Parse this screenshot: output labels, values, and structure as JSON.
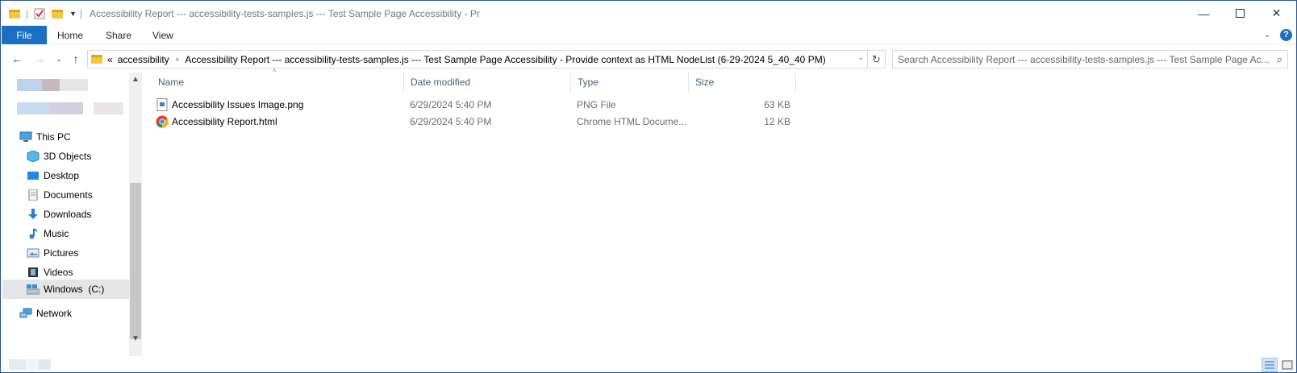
{
  "window": {
    "title": "Accessibility Report --- accessibility-tests-samples.js --- Test Sample Page Accessibility - Pr",
    "accent_color": "#1a6fc4"
  },
  "ribbon": {
    "tabs": [
      "File",
      "Home",
      "Share",
      "View"
    ]
  },
  "address": {
    "overflow_glyph": "«",
    "crumbs": [
      "accessibility",
      "Accessibility Report --- accessibility-tests-samples.js --- Test Sample Page Accessibility - Provide context as HTML NodeList (6-29-2024 5_40_40 PM)"
    ],
    "search_placeholder": "Search Accessibility Report --- accessibility-tests-samples.js --- Test Sample Page Ac..."
  },
  "nav": {
    "items": [
      {
        "label": "This PC",
        "icon": "computer-icon"
      },
      {
        "label": "3D Objects",
        "icon": "cube-icon"
      },
      {
        "label": "Desktop",
        "icon": "desktop-icon"
      },
      {
        "label": "Documents",
        "icon": "documents-icon"
      },
      {
        "label": "Downloads",
        "icon": "download-arrow-icon"
      },
      {
        "label": "Music",
        "icon": "music-note-icon"
      },
      {
        "label": "Pictures",
        "icon": "pictures-icon"
      },
      {
        "label": "Videos",
        "icon": "film-icon"
      },
      {
        "label": "Windows  (C:)",
        "icon": "drive-icon"
      },
      {
        "label": "Network",
        "icon": "network-icon"
      }
    ],
    "selected": "Windows  (C:)"
  },
  "columns": [
    "Name",
    "Date modified",
    "Type",
    "Size"
  ],
  "files": [
    {
      "name": "Accessibility Issues Image.png",
      "date": "6/29/2024 5:40 PM",
      "type": "PNG File",
      "size": "63 KB",
      "icon": "image-file-icon"
    },
    {
      "name": "Accessibility Report.html",
      "date": "6/29/2024 5:40 PM",
      "type": "Chrome HTML Docume...",
      "size": "12 KB",
      "icon": "chrome-icon"
    }
  ]
}
